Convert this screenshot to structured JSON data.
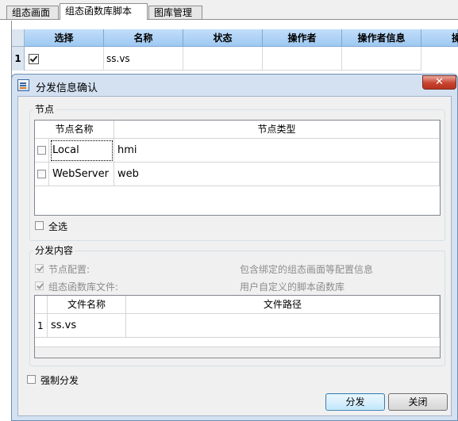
{
  "background_window": {
    "tabs": [
      {
        "label": "组态画面",
        "active": false
      },
      {
        "label": "组态函数库脚本",
        "active": true
      },
      {
        "label": "图库管理",
        "active": false
      }
    ],
    "columns": [
      "选择",
      "名称",
      "状态",
      "操作者",
      "操作者信息",
      "操"
    ],
    "rows": [
      {
        "index": "1",
        "selected": true,
        "name": "ss.vs"
      }
    ]
  },
  "dialog": {
    "title": "分发信息确认",
    "close_label": "✕",
    "nodes_group": {
      "title": "节点",
      "columns": [
        "节点名称",
        "节点类型"
      ],
      "rows": [
        {
          "name": "Local",
          "type": "hmi",
          "checked": false
        },
        {
          "name": "WebServer",
          "type": "web",
          "checked": false
        }
      ],
      "select_all_label": "全选",
      "select_all_checked": false
    },
    "content_group": {
      "title": "分发内容",
      "options": [
        {
          "label": "节点配置:",
          "description": "包含绑定的组态画面等配置信息",
          "checked": true,
          "enabled": false
        },
        {
          "label": "组态函数库文件:",
          "description": "用户自定义的脚本函数库",
          "checked": true,
          "enabled": false
        }
      ],
      "file_columns": [
        "文件名称",
        "文件路径"
      ],
      "files": [
        {
          "index": "1",
          "name": "ss.vs",
          "path": ""
        }
      ]
    },
    "force_label": "强制分发",
    "force_checked": false,
    "buttons": {
      "distribute": "分发",
      "close": "关闭"
    }
  }
}
